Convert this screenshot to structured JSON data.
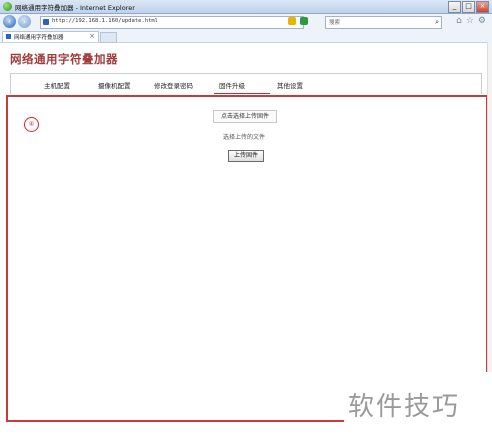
{
  "browser": {
    "window_title": "网络通用字符叠加器 - Internet Explorer",
    "address": "http://192.168.1.160/update.html",
    "search_placeholder": "搜索",
    "tab_title": "网络通用字符叠加器",
    "tab_close": "×"
  },
  "window_controls": {
    "minimize": "_",
    "maximize": "□",
    "close": "×"
  },
  "page": {
    "title": "网络通用字符叠加器",
    "nav": [
      {
        "label": "主机配置"
      },
      {
        "label": "摄像机配置"
      },
      {
        "label": "修改登录密码"
      },
      {
        "label": "固件升级",
        "active": true
      },
      {
        "label": "其他设置"
      }
    ],
    "step_badge": "④",
    "choose_button": "点击选择上传固件",
    "selected_file_text": "选择上传的文件",
    "upload_button": "上传固件"
  },
  "watermark": "软件技巧",
  "colors": {
    "accent": "#c63b3b",
    "title": "#a13a3a"
  },
  "icons": [
    "ie-logo-icon",
    "back-icon",
    "forward-icon",
    "page-icon",
    "search-icon",
    "home-icon",
    "star-icon",
    "gear-icon"
  ]
}
